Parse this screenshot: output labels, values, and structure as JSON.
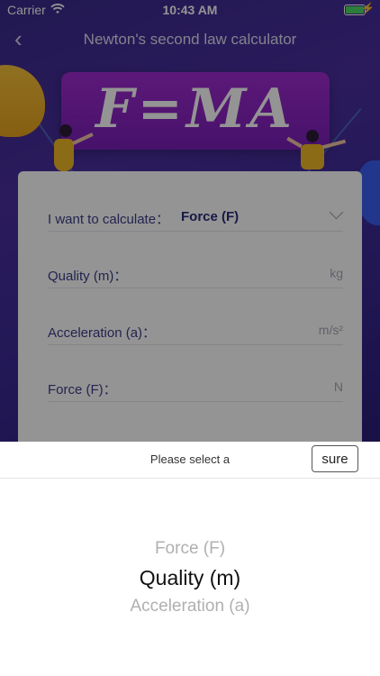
{
  "status_bar": {
    "carrier": "Carrier",
    "time": "10:43 AM"
  },
  "nav": {
    "title": "Newton's second law calculator"
  },
  "banner": {
    "formula": "F=MA"
  },
  "form": {
    "calc_label": "I want to calculate：",
    "calc_value": "Force (F)",
    "rows": [
      {
        "label": "Quality (m)：",
        "unit": "kg"
      },
      {
        "label": "Acceleration (a)：",
        "unit": "m/s²"
      },
      {
        "label": "Force (F)：",
        "unit": "N"
      }
    ]
  },
  "picker": {
    "prompt": "Please select a",
    "sure_label": "sure",
    "options": [
      "Force (F)",
      "Quality (m)",
      "Acceleration (a)"
    ],
    "selected": "Quality (m)"
  },
  "colors": {
    "accent": "#3d3d8a",
    "hero": "#3a2a8c",
    "banner": "#a02bd0"
  }
}
